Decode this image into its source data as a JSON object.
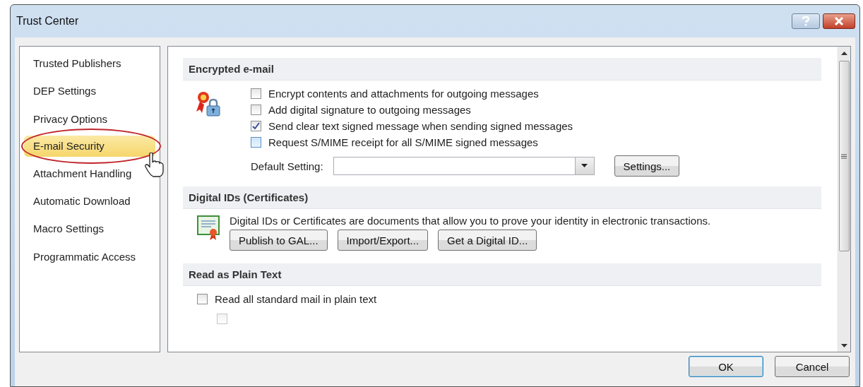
{
  "window": {
    "title": "Trust Center"
  },
  "sidebar": {
    "items": [
      {
        "label": "Trusted Publishers",
        "selected": false
      },
      {
        "label": "DEP Settings",
        "selected": false
      },
      {
        "label": "Privacy Options",
        "selected": false
      },
      {
        "label": "E-mail Security",
        "selected": true
      },
      {
        "label": "Attachment Handling",
        "selected": false
      },
      {
        "label": "Automatic Download",
        "selected": false
      },
      {
        "label": "Macro Settings",
        "selected": false
      },
      {
        "label": "Programmatic Access",
        "selected": false
      }
    ]
  },
  "encrypted_email": {
    "heading": "Encrypted e-mail",
    "options": [
      {
        "label": "Encrypt contents and attachments for outgoing messages",
        "checked": false
      },
      {
        "label": "Add digital signature to outgoing messages",
        "checked": false
      },
      {
        "label": "Send clear text signed message when sending signed messages",
        "checked": true
      },
      {
        "label": "Request S/MIME receipt for all S/MIME signed messages",
        "checked": false
      }
    ],
    "default_setting": {
      "label": "Default Setting:"
    },
    "settings_button": "Settings..."
  },
  "digital_ids": {
    "heading": "Digital IDs (Certificates)",
    "description": "Digital IDs or Certificates are documents that allow you to prove your identity in electronic transactions.",
    "buttons": [
      "Publish to GAL...",
      "Import/Export...",
      "Get a Digital ID..."
    ]
  },
  "read_as_plain_text": {
    "heading": "Read as Plain Text",
    "options": [
      {
        "label": "Read all standard mail in plain text",
        "checked": false
      },
      {
        "checked": false
      }
    ]
  },
  "buttons": [
    "OK",
    "Cancel"
  ]
}
